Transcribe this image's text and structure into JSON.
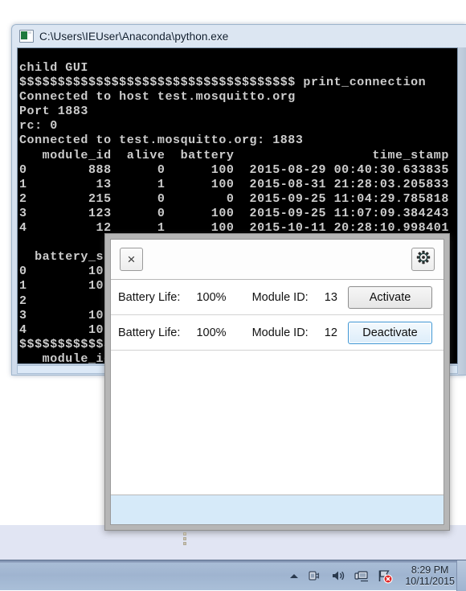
{
  "console_window": {
    "title": "C:\\Users\\IEUser\\Anaconda\\python.exe",
    "icon": "python-console-icon",
    "output": "child GUI\n$$$$$$$$$$$$$$$$$$$$$$$$$$$$$$$$$$$$ print_connection\nConnected to host test.mosquitto.org\nPort 1883\nrc: 0\nConnected to test.mosquitto.org: 1883\n   module_id  alive  battery                  time_stamp\n0        888      0      100  2015-08-29 00:40:30.633835\n1         13      1      100  2015-08-31 21:28:03.205833\n2        215      0        0  2015-09-25 11:04:29.785818\n3        123      0      100  2015-09-25 11:07:09.384243\n4         12      1      100  2015-10-11 20:28:10.998401\n\n  battery_str\n0        100%\n1        100%\n2            \n3        100%\n4        100%\n$$$$$$$$$$$$$$$$$$$$$$$$$$$$$$$$$$$$ print_loop\n   module_id  alive  battery                  time_stamp\n0        888      0      100  2015-08-29 00:40:30.633835\n1         13      1      100  2015-08-31 21:28:03.205833\n2        215      0        0  2015-09-25 11:04:29.785818\n3        123      0      100  2015-09-25 11:07:09.384243\n4         12      1      100  2015-10-11 20:28:10.998401"
  },
  "dialog": {
    "toolbar": {
      "close_label": "×",
      "settings_icon": "gear-icon"
    },
    "rows": [
      {
        "battery_label": "Battery Life:",
        "battery_value": "100%",
        "module_label": "Module ID:",
        "module_value": "13",
        "button_label": "Activate",
        "button_state": "normal"
      },
      {
        "battery_label": "Battery Life:",
        "battery_value": "100%",
        "module_label": "Module ID:",
        "module_value": "12",
        "button_label": "Deactivate",
        "button_state": "focused"
      }
    ],
    "status_bar_color": "#d6eaf9"
  },
  "taskbar": {
    "tray_icons": [
      "show-hidden-icons-arrow",
      "power-plug-icon",
      "volume-icon",
      "network-monitor-icon",
      "network-error-icon"
    ],
    "time": "8:29 PM",
    "date": "10/11/2015"
  },
  "colors": {
    "desktop": "#e1e5f3",
    "taskbar": "#a9bdd6",
    "console_bg": "#000000",
    "console_text": "#cccccc",
    "accent_focus": "#3c95d4",
    "status_bar": "#d6eaf9"
  }
}
